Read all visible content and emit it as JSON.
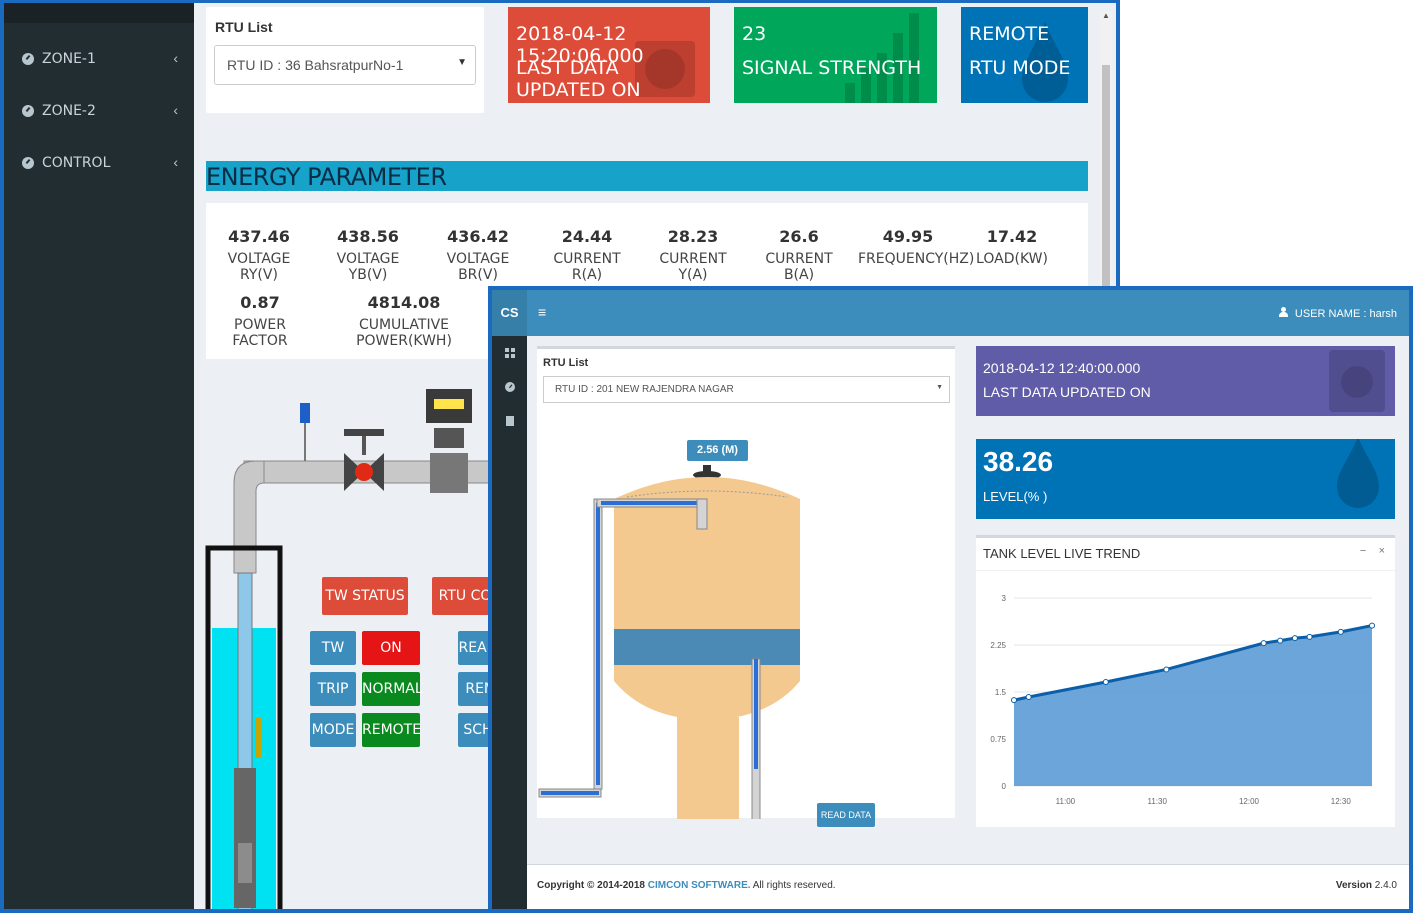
{
  "back": {
    "sidebar": {
      "items": [
        {
          "label": "ZONE-1",
          "icon": "dashboard-icon"
        },
        {
          "label": "ZONE-2",
          "icon": "dashboard-icon"
        },
        {
          "label": "CONTROL",
          "icon": "dashboard-icon"
        }
      ]
    },
    "rtu_list": {
      "label": "RTU List",
      "selected": "RTU ID : 36 BahsratpurNo-1"
    },
    "info_boxes": {
      "last_update": {
        "value": "2018-04-12 15:20:06.000",
        "label": "LAST DATA UPDATED ON",
        "color": "#dd4b39"
      },
      "signal": {
        "value": "23",
        "label": "SIGNAL STRENGTH",
        "color": "#00a65a"
      },
      "mode": {
        "value": "REMOTE",
        "label": "RTU MODE",
        "color": "#0073b7"
      }
    },
    "energy": {
      "title": "ENERGY PARAMETER",
      "params": [
        {
          "value": "437.46",
          "name": "VOLTAGE RY(V)"
        },
        {
          "value": "438.56",
          "name": "VOLTAGE YB(V)"
        },
        {
          "value": "436.42",
          "name": "VOLTAGE BR(V)"
        },
        {
          "value": "24.44",
          "name": "CURRENT R(A)"
        },
        {
          "value": "28.23",
          "name": "CURRENT Y(A)"
        },
        {
          "value": "26.6",
          "name": "CURRENT B(A)"
        },
        {
          "value": "49.95",
          "name": "FREQUENCY(HZ)"
        },
        {
          "value": "17.42",
          "name": "LOAD(KW)"
        },
        {
          "value": "0.87",
          "name": "POWER FACTOR"
        },
        {
          "value": "4814.08",
          "name": "CUMULATIVE POWER(KWH)"
        }
      ]
    },
    "status": {
      "tw_status": "TW STATUS",
      "rtu_col": "RTU CO",
      "rows": [
        {
          "name": "TW",
          "state": "ON"
        },
        {
          "name": "TRIP",
          "state": "NORMAL"
        },
        {
          "name": "MODE",
          "state": "REMOTE"
        }
      ],
      "side_buttons": [
        "READ",
        "REM",
        "SCH"
      ]
    }
  },
  "front": {
    "header": {
      "logo": "CS",
      "user_label": "USER NAME : harsh"
    },
    "rtu_list": {
      "label": "RTU List",
      "selected": "RTU ID : 201 NEW RAJENDRA NAGAR"
    },
    "tank": {
      "level_tag": "2.56 (M)",
      "read_button": "READ DATA",
      "fill_fraction": 0.38
    },
    "last_update": {
      "value": "2018-04-12 12:40:00.000",
      "label": "LAST DATA UPDATED ON",
      "color": "#605ca8"
    },
    "level": {
      "value": "38.26",
      "label": "LEVEL(% )",
      "color": "#0073b7"
    },
    "trend": {
      "title": "TANK LEVEL LIVE TREND",
      "minimize": "−",
      "close": "×"
    },
    "footer": {
      "copyright": "Copyright © 2014-2018",
      "brand": "CIMCON SOFTWARE.",
      "rights": "All rights reserved.",
      "version_label": "Version",
      "version": "2.4.0"
    }
  },
  "chart_data": {
    "type": "area",
    "title": "TANK LEVEL LIVE TREND",
    "xlabel": "",
    "ylabel": "",
    "x_ticks": [
      "11:00",
      "11:30",
      "12:00",
      "12:30"
    ],
    "y_ticks": [
      "0",
      "0.75",
      "1.5",
      "2.25",
      "3"
    ],
    "ylim": [
      0,
      3
    ],
    "xlim_minutes": [
      10.72,
      12.67
    ],
    "series": [
      {
        "x": [
          "10:43",
          "10:48",
          "11:13",
          "11:33",
          "12:05",
          "12:10",
          "12:15",
          "12:20",
          "12:30",
          "12:40"
        ],
        "x_hours": [
          10.72,
          10.8,
          11.22,
          11.55,
          12.08,
          12.17,
          12.25,
          12.33,
          12.5,
          12.67
        ],
        "y": [
          1.37,
          1.42,
          1.66,
          1.86,
          2.28,
          2.32,
          2.36,
          2.38,
          2.46,
          2.56
        ]
      }
    ],
    "grid": true,
    "fill_color": "#5b9bd5",
    "line_color": "#0b5ea8"
  }
}
